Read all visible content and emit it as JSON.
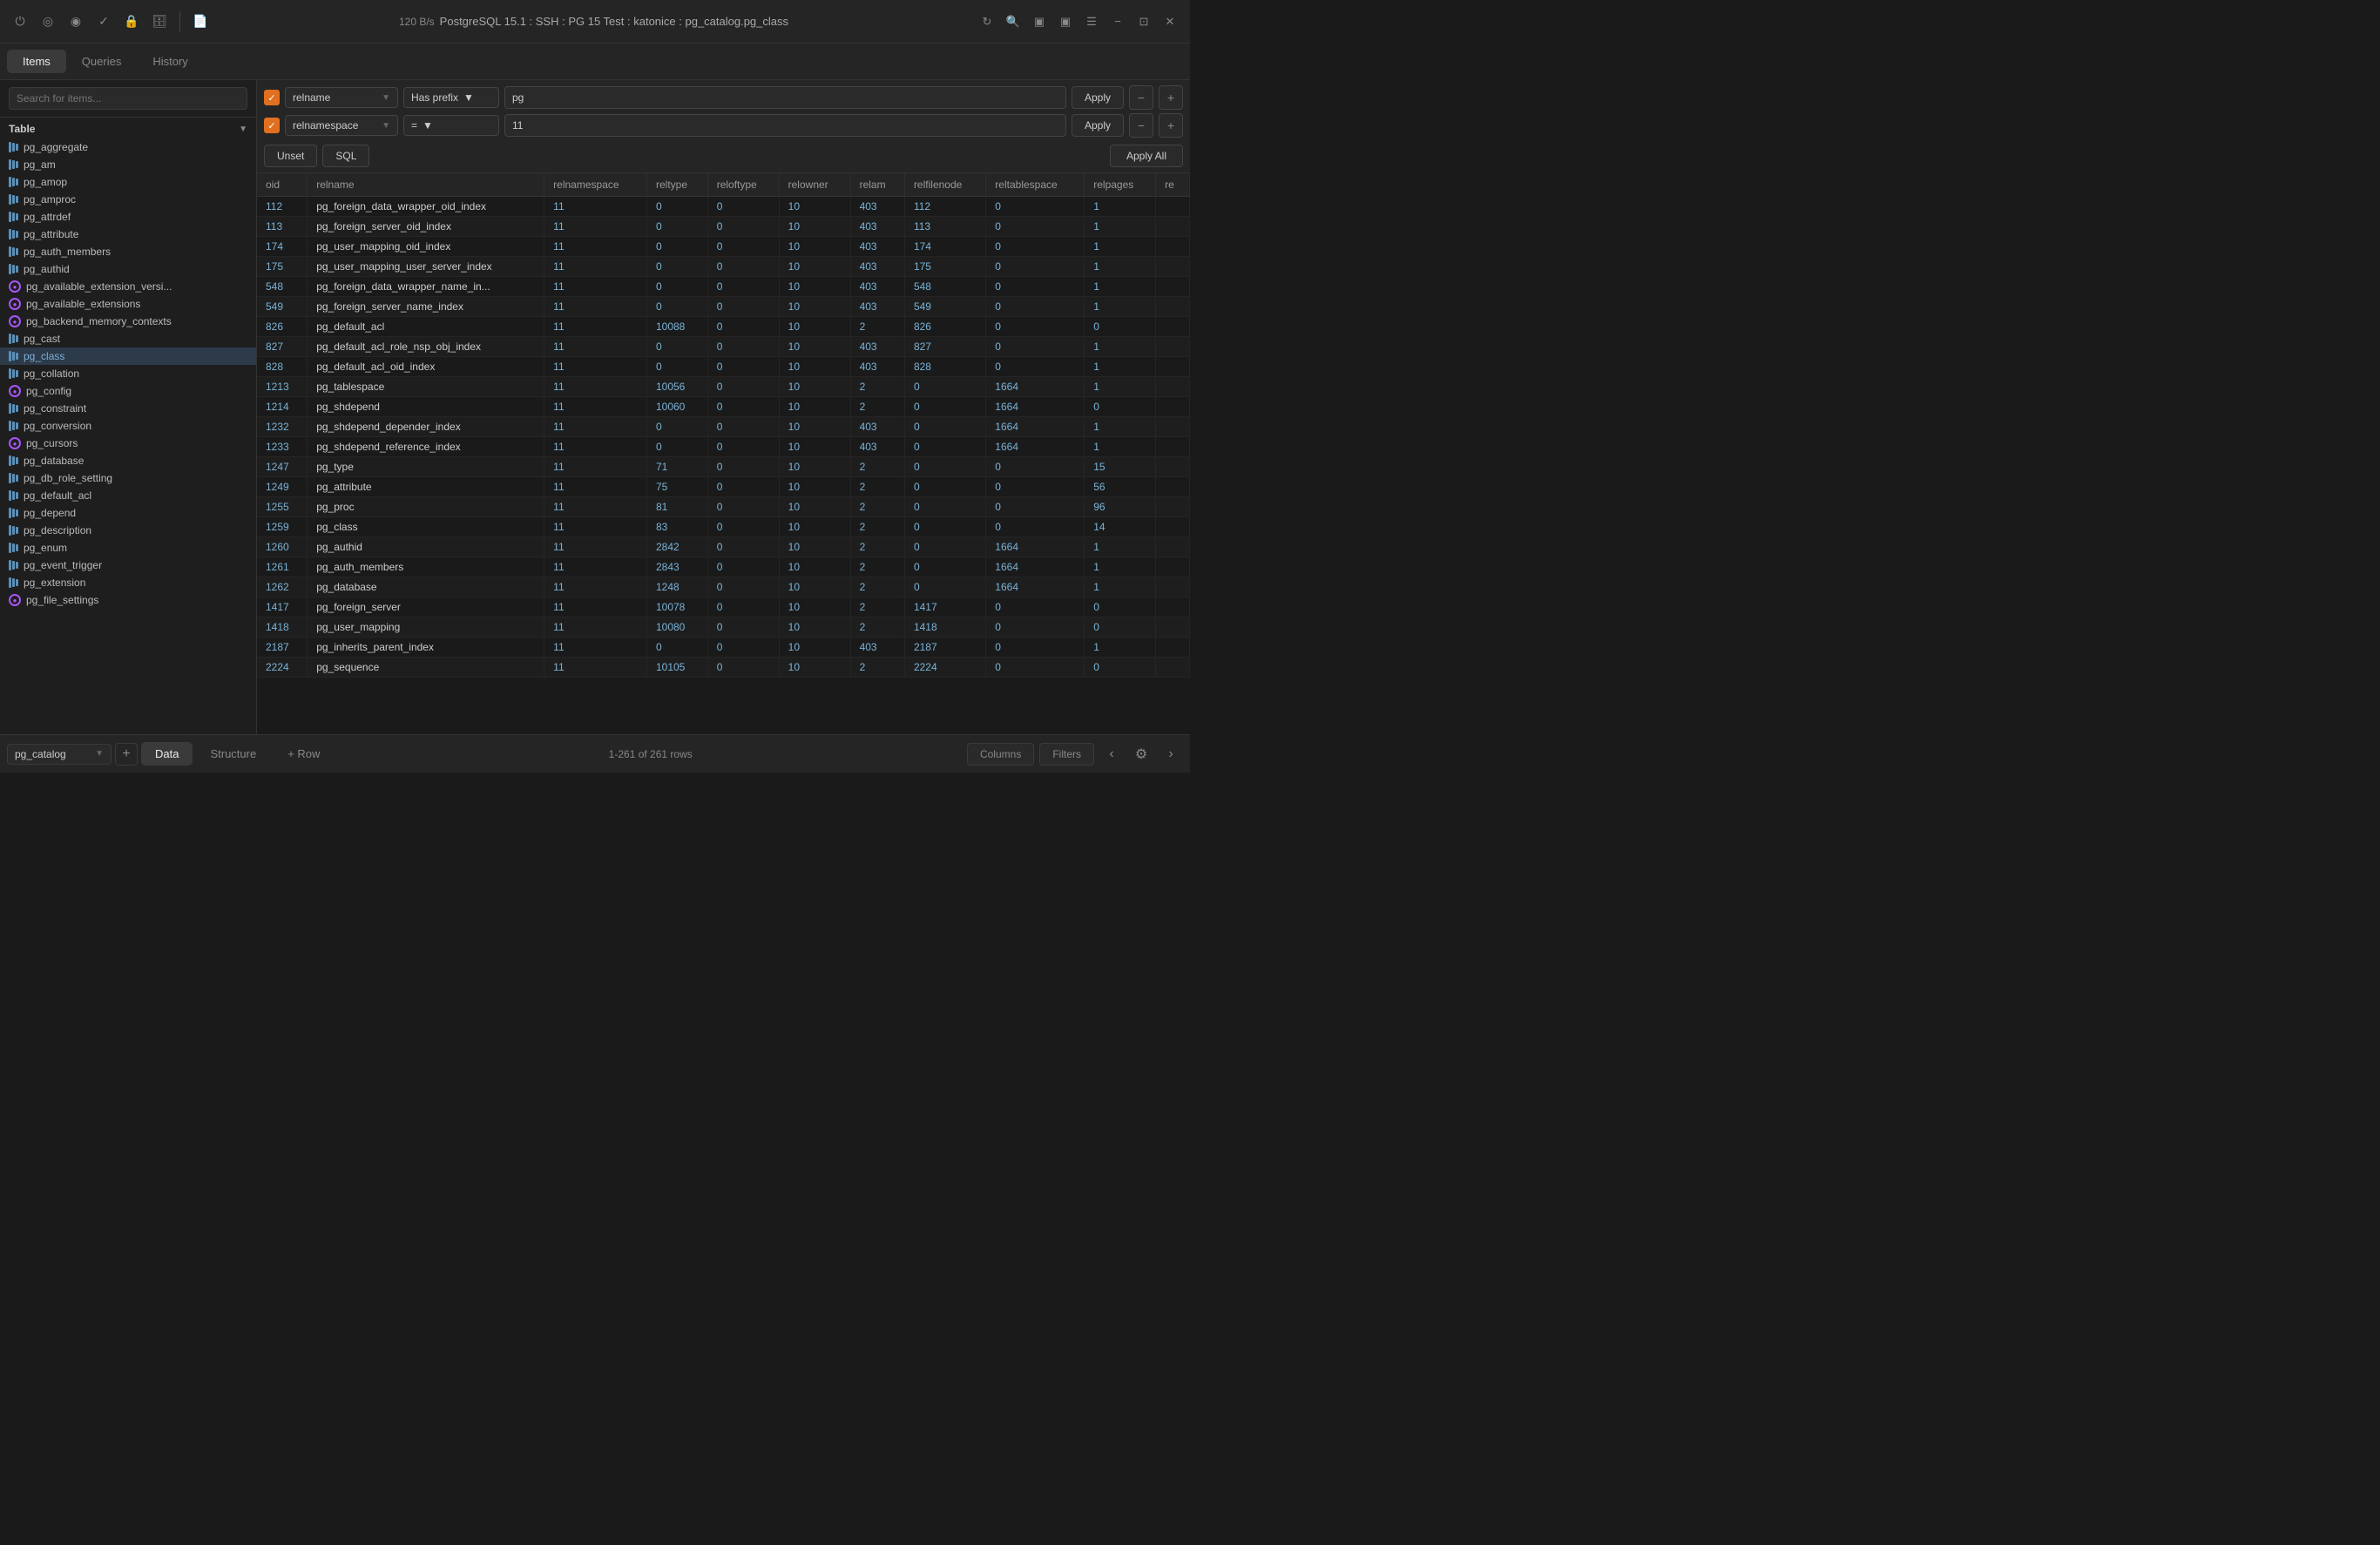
{
  "titlebar": {
    "speed": "120 B/s",
    "connection": "PostgreSQL 15.1 : SSH : PG 15 Test : katonice : pg_catalog.pg_class"
  },
  "tabs": {
    "items_label": "Items",
    "queries_label": "Queries",
    "history_label": "History"
  },
  "sidebar": {
    "search_placeholder": "Search for items...",
    "section_label": "Table",
    "items": [
      {
        "name": "pg_aggregate",
        "type": "table"
      },
      {
        "name": "pg_am",
        "type": "table"
      },
      {
        "name": "pg_amop",
        "type": "table"
      },
      {
        "name": "pg_amproc",
        "type": "table"
      },
      {
        "name": "pg_attrdef",
        "type": "table"
      },
      {
        "name": "pg_attribute",
        "type": "table"
      },
      {
        "name": "pg_auth_members",
        "type": "table"
      },
      {
        "name": "pg_authid",
        "type": "table"
      },
      {
        "name": "pg_available_extension_versi...",
        "type": "view"
      },
      {
        "name": "pg_available_extensions",
        "type": "view"
      },
      {
        "name": "pg_backend_memory_contexts",
        "type": "view"
      },
      {
        "name": "pg_cast",
        "type": "table"
      },
      {
        "name": "pg_class",
        "type": "table",
        "selected": true
      },
      {
        "name": "pg_collation",
        "type": "table"
      },
      {
        "name": "pg_config",
        "type": "view"
      },
      {
        "name": "pg_constraint",
        "type": "table"
      },
      {
        "name": "pg_conversion",
        "type": "table"
      },
      {
        "name": "pg_cursors",
        "type": "view"
      },
      {
        "name": "pg_database",
        "type": "table"
      },
      {
        "name": "pg_db_role_setting",
        "type": "table"
      },
      {
        "name": "pg_default_acl",
        "type": "table"
      },
      {
        "name": "pg_depend",
        "type": "table"
      },
      {
        "name": "pg_description",
        "type": "table"
      },
      {
        "name": "pg_enum",
        "type": "table"
      },
      {
        "name": "pg_event_trigger",
        "type": "table"
      },
      {
        "name": "pg_extension",
        "type": "table"
      },
      {
        "name": "pg_file_settings",
        "type": "view"
      }
    ]
  },
  "filters": {
    "filter1": {
      "field": "relname",
      "operator": "Has prefix",
      "value": "pg"
    },
    "filter2": {
      "field": "relnamespace",
      "operator": "=",
      "value": "11"
    },
    "unset_label": "Unset",
    "sql_label": "SQL",
    "apply_label": "Apply",
    "apply_all_label": "Apply All"
  },
  "table": {
    "columns": [
      "oid",
      "relname",
      "relnamespace",
      "reltype",
      "reloftype",
      "relowner",
      "relam",
      "relfilenode",
      "reltablespace",
      "relpages",
      "re"
    ],
    "rows": [
      {
        "oid": "112",
        "relname": "pg_foreign_data_wrapper_oid_index",
        "relnamespace": "11",
        "reltype": "0",
        "reloftype": "0",
        "relowner": "10",
        "relam": "403",
        "relfilenode": "112",
        "reltablespace": "0",
        "relpages": "1"
      },
      {
        "oid": "113",
        "relname": "pg_foreign_server_oid_index",
        "relnamespace": "11",
        "reltype": "0",
        "reloftype": "0",
        "relowner": "10",
        "relam": "403",
        "relfilenode": "113",
        "reltablespace": "0",
        "relpages": "1"
      },
      {
        "oid": "174",
        "relname": "pg_user_mapping_oid_index",
        "relnamespace": "11",
        "reltype": "0",
        "reloftype": "0",
        "relowner": "10",
        "relam": "403",
        "relfilenode": "174",
        "reltablespace": "0",
        "relpages": "1"
      },
      {
        "oid": "175",
        "relname": "pg_user_mapping_user_server_index",
        "relnamespace": "11",
        "reltype": "0",
        "reloftype": "0",
        "relowner": "10",
        "relam": "403",
        "relfilenode": "175",
        "reltablespace": "0",
        "relpages": "1"
      },
      {
        "oid": "548",
        "relname": "pg_foreign_data_wrapper_name_in...",
        "relnamespace": "11",
        "reltype": "0",
        "reloftype": "0",
        "relowner": "10",
        "relam": "403",
        "relfilenode": "548",
        "reltablespace": "0",
        "relpages": "1"
      },
      {
        "oid": "549",
        "relname": "pg_foreign_server_name_index",
        "relnamespace": "11",
        "reltype": "0",
        "reloftype": "0",
        "relowner": "10",
        "relam": "403",
        "relfilenode": "549",
        "reltablespace": "0",
        "relpages": "1"
      },
      {
        "oid": "826",
        "relname": "pg_default_acl",
        "relnamespace": "11",
        "reltype": "10088",
        "reloftype": "0",
        "relowner": "10",
        "relam": "2",
        "relfilenode": "826",
        "reltablespace": "0",
        "relpages": "0"
      },
      {
        "oid": "827",
        "relname": "pg_default_acl_role_nsp_obj_index",
        "relnamespace": "11",
        "reltype": "0",
        "reloftype": "0",
        "relowner": "10",
        "relam": "403",
        "relfilenode": "827",
        "reltablespace": "0",
        "relpages": "1"
      },
      {
        "oid": "828",
        "relname": "pg_default_acl_oid_index",
        "relnamespace": "11",
        "reltype": "0",
        "reloftype": "0",
        "relowner": "10",
        "relam": "403",
        "relfilenode": "828",
        "reltablespace": "0",
        "relpages": "1"
      },
      {
        "oid": "1213",
        "relname": "pg_tablespace",
        "relnamespace": "11",
        "reltype": "10056",
        "reloftype": "0",
        "relowner": "10",
        "relam": "2",
        "relfilenode": "0",
        "reltablespace": "1664",
        "relpages": "1"
      },
      {
        "oid": "1214",
        "relname": "pg_shdepend",
        "relnamespace": "11",
        "reltype": "10060",
        "reloftype": "0",
        "relowner": "10",
        "relam": "2",
        "relfilenode": "0",
        "reltablespace": "1664",
        "relpages": "0"
      },
      {
        "oid": "1232",
        "relname": "pg_shdepend_depender_index",
        "relnamespace": "11",
        "reltype": "0",
        "reloftype": "0",
        "relowner": "10",
        "relam": "403",
        "relfilenode": "0",
        "reltablespace": "1664",
        "relpages": "1"
      },
      {
        "oid": "1233",
        "relname": "pg_shdepend_reference_index",
        "relnamespace": "11",
        "reltype": "0",
        "reloftype": "0",
        "relowner": "10",
        "relam": "403",
        "relfilenode": "0",
        "reltablespace": "1664",
        "relpages": "1"
      },
      {
        "oid": "1247",
        "relname": "pg_type",
        "relnamespace": "11",
        "reltype": "71",
        "reloftype": "0",
        "relowner": "10",
        "relam": "2",
        "relfilenode": "0",
        "reltablespace": "0",
        "relpages": "15"
      },
      {
        "oid": "1249",
        "relname": "pg_attribute",
        "relnamespace": "11",
        "reltype": "75",
        "reloftype": "0",
        "relowner": "10",
        "relam": "2",
        "relfilenode": "0",
        "reltablespace": "0",
        "relpages": "56"
      },
      {
        "oid": "1255",
        "relname": "pg_proc",
        "relnamespace": "11",
        "reltype": "81",
        "reloftype": "0",
        "relowner": "10",
        "relam": "2",
        "relfilenode": "0",
        "reltablespace": "0",
        "relpages": "96"
      },
      {
        "oid": "1259",
        "relname": "pg_class",
        "relnamespace": "11",
        "reltype": "83",
        "reloftype": "0",
        "relowner": "10",
        "relam": "2",
        "relfilenode": "0",
        "reltablespace": "0",
        "relpages": "14"
      },
      {
        "oid": "1260",
        "relname": "pg_authid",
        "relnamespace": "11",
        "reltype": "2842",
        "reloftype": "0",
        "relowner": "10",
        "relam": "2",
        "relfilenode": "0",
        "reltablespace": "1664",
        "relpages": "1"
      },
      {
        "oid": "1261",
        "relname": "pg_auth_members",
        "relnamespace": "11",
        "reltype": "2843",
        "reloftype": "0",
        "relowner": "10",
        "relam": "2",
        "relfilenode": "0",
        "reltablespace": "1664",
        "relpages": "1"
      },
      {
        "oid": "1262",
        "relname": "pg_database",
        "relnamespace": "11",
        "reltype": "1248",
        "reloftype": "0",
        "relowner": "10",
        "relam": "2",
        "relfilenode": "0",
        "reltablespace": "1664",
        "relpages": "1"
      },
      {
        "oid": "1417",
        "relname": "pg_foreign_server",
        "relnamespace": "11",
        "reltype": "10078",
        "reloftype": "0",
        "relowner": "10",
        "relam": "2",
        "relfilenode": "1417",
        "reltablespace": "0",
        "relpages": "0"
      },
      {
        "oid": "1418",
        "relname": "pg_user_mapping",
        "relnamespace": "11",
        "reltype": "10080",
        "reloftype": "0",
        "relowner": "10",
        "relam": "2",
        "relfilenode": "1418",
        "reltablespace": "0",
        "relpages": "0"
      },
      {
        "oid": "2187",
        "relname": "pg_inherits_parent_index",
        "relnamespace": "11",
        "reltype": "0",
        "reloftype": "0",
        "relowner": "10",
        "relam": "403",
        "relfilenode": "2187",
        "reltablespace": "0",
        "relpages": "1"
      },
      {
        "oid": "2224",
        "relname": "pg_sequence",
        "relnamespace": "11",
        "reltype": "10105",
        "reloftype": "0",
        "relowner": "10",
        "relam": "2",
        "relfilenode": "2224",
        "reltablespace": "0",
        "relpages": "0"
      }
    ]
  },
  "bottombar": {
    "data_label": "Data",
    "structure_label": "Structure",
    "row_label": "+ Row",
    "row_info": "1-261 of 261 rows",
    "columns_label": "Columns",
    "filters_label": "Filters",
    "schema_label": "pg_catalog"
  }
}
